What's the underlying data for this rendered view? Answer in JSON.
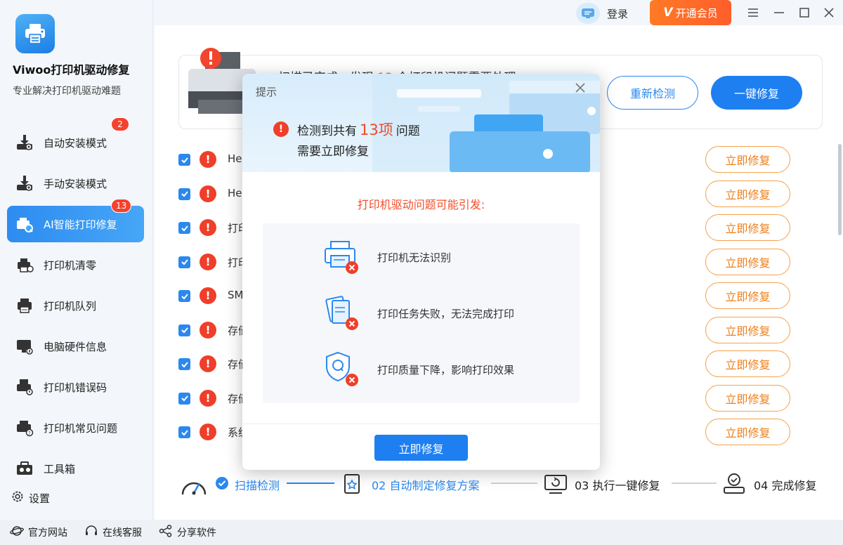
{
  "app": {
    "title": "Viwoo打印机驱动修复",
    "subtitle": "专业解决打印机驱动难题"
  },
  "sidebar": {
    "items": [
      {
        "label": "自动安装模式",
        "badge": "2"
      },
      {
        "label": "手动安装模式"
      },
      {
        "label": "AI智能打印修复",
        "badge": "13",
        "active": true
      },
      {
        "label": "打印机清零"
      },
      {
        "label": "打印机队列"
      },
      {
        "label": "电脑硬件信息"
      },
      {
        "label": "打印机错误码"
      },
      {
        "label": "打印机常见问题"
      },
      {
        "label": "工具箱"
      }
    ],
    "settings_label": "设置"
  },
  "titlebar": {
    "login_label": "登录",
    "vip_label": "开通会员"
  },
  "scan": {
    "text_prefix": "扫描已完成，发现",
    "count": "13",
    "text_suffix": "个打印机问题需要处理",
    "rescan_label": "重新检测",
    "fixall_label": "一键修复"
  },
  "issues": [
    {
      "text": "He",
      "fix_label": "立即修复"
    },
    {
      "text": "He",
      "fix_label": "立即修复"
    },
    {
      "text": "打印",
      "fix_label": "立即修复"
    },
    {
      "text": "打印",
      "fix_label": "立即修复"
    },
    {
      "text": "SM",
      "fix_label": "立即修复"
    },
    {
      "text": "存储",
      "fix_label": "立即修复"
    },
    {
      "text": "存储",
      "fix_label": "立即修复"
    },
    {
      "text": "存储",
      "fix_label": "立即修复"
    },
    {
      "text": "系统",
      "fix_label": "立即修复"
    }
  ],
  "steps": [
    {
      "label": "扫描检测",
      "done": true
    },
    {
      "label": "02 自动制定修复方案"
    },
    {
      "label": "03 执行一键修复"
    },
    {
      "label": "04 完成修复"
    }
  ],
  "bottom": {
    "website": "官方网站",
    "service": "在线客服",
    "share": "分享软件"
  },
  "modal": {
    "title": "提示",
    "detect_prefix": "检测到共有",
    "detect_count": "13项",
    "detect_suffix": "问题",
    "detect_line2": "需要立即修复",
    "cause_title": "打印机驱动问题可能引发:",
    "causes": [
      {
        "text": "打印机无法识别",
        "icon": "printer-error-icon"
      },
      {
        "text": "打印任务失败，无法完成打印",
        "icon": "document-error-icon"
      },
      {
        "text": "打印质量下降，影响打印效果",
        "icon": "quality-shield-error-icon"
      }
    ],
    "fix_label": "立即修复"
  },
  "colors": {
    "primary": "#1e7ff0",
    "warning": "#ef3f2a",
    "orange": "#f5a24a",
    "vip": "#ff6a28"
  }
}
